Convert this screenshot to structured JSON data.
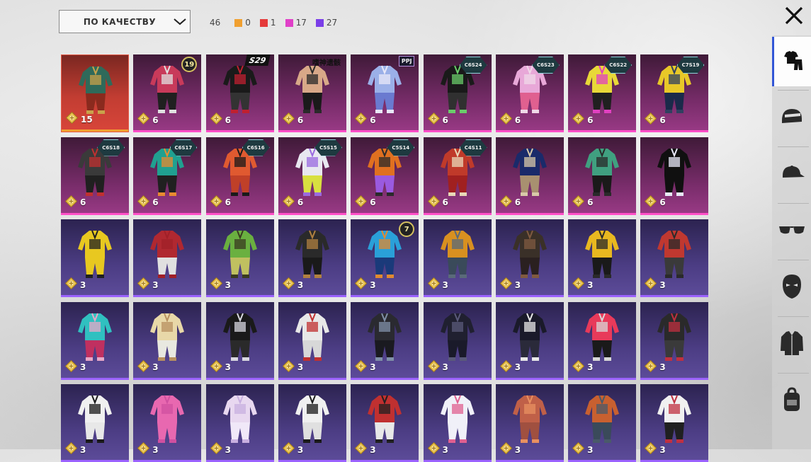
{
  "sort": {
    "label": "ПО КАЧЕСТВУ"
  },
  "counts": {
    "total": "46",
    "items": [
      {
        "value": "0",
        "color": "#f0a030"
      },
      {
        "value": "1",
        "color": "#e53a3a"
      },
      {
        "value": "17",
        "color": "#e040c8"
      },
      {
        "value": "27",
        "color": "#7a3ee8"
      }
    ]
  },
  "colors": {
    "accent": "#3256d6",
    "gold_bar": "#f0a030",
    "pink_bar": "#ff4fc8",
    "violet_bar": "#9b62ff"
  },
  "items": [
    {
      "rarity": "gold",
      "cost": "15",
      "badge": "",
      "btype": "",
      "palette": [
        "#2f6a5a",
        "#c9a24a",
        "#8a2a1e"
      ]
    },
    {
      "rarity": "pink",
      "cost": "6",
      "badge": "19",
      "btype": "circle",
      "palette": [
        "#c83a5a",
        "#e0e0e0",
        "#202020"
      ]
    },
    {
      "rarity": "pink",
      "cost": "6",
      "badge": "S29",
      "btype": "s29",
      "palette": [
        "#1a1a1a",
        "#c02030",
        "#333"
      ]
    },
    {
      "rarity": "pink",
      "cost": "6",
      "badge": "嗜神遗骸",
      "btype": "script",
      "palette": [
        "#d8a888",
        "#2a2a2a",
        "#1a1a1a"
      ]
    },
    {
      "rarity": "pink",
      "cost": "6",
      "badge": "PPJ",
      "btype": "tag",
      "palette": [
        "#9bb0e8",
        "#e8e8f8",
        "#6a7ad0"
      ]
    },
    {
      "rarity": "pink",
      "cost": "6",
      "badge": "C6S24",
      "btype": "hex",
      "palette": [
        "#1a1a1a",
        "#6acc6a",
        "#303030"
      ]
    },
    {
      "rarity": "pink",
      "cost": "6",
      "badge": "C6S23",
      "btype": "hex",
      "palette": [
        "#e8a8d8",
        "#f0d8e8",
        "#e06090"
      ]
    },
    {
      "rarity": "pink",
      "cost": "6",
      "badge": "C6S22",
      "btype": "hex",
      "palette": [
        "#e8d838",
        "#e040c0",
        "#202020"
      ]
    },
    {
      "rarity": "pink",
      "cost": "6",
      "badge": "C7S19",
      "btype": "hex",
      "palette": [
        "#e8c828",
        "#304060",
        "#1a2a4a"
      ]
    },
    {
      "rarity": "pink",
      "cost": "6",
      "badge": "C6S18",
      "btype": "hex",
      "palette": [
        "#3a3a3a",
        "#c03030",
        "#202020"
      ]
    },
    {
      "rarity": "pink",
      "cost": "6",
      "badge": "C6S17",
      "btype": "hex",
      "palette": [
        "#20a090",
        "#e88a30",
        "#202020"
      ]
    },
    {
      "rarity": "pink",
      "cost": "6",
      "badge": "C6S16",
      "btype": "hex",
      "palette": [
        "#e05a30",
        "#1a1a1a",
        "#c04028"
      ]
    },
    {
      "rarity": "pink",
      "cost": "6",
      "badge": "C5S15",
      "btype": "hex",
      "palette": [
        "#e8e8f0",
        "#9a6ae0",
        "#d8e040"
      ]
    },
    {
      "rarity": "pink",
      "cost": "6",
      "badge": "C5S14",
      "btype": "hex",
      "palette": [
        "#e07020",
        "#2a2a2a",
        "#9a5ae0"
      ]
    },
    {
      "rarity": "pink",
      "cost": "6",
      "badge": "C4S11",
      "btype": "hex",
      "palette": [
        "#c03a2a",
        "#e8d8b8",
        "#a02020"
      ]
    },
    {
      "rarity": "pink",
      "cost": "6",
      "badge": "",
      "btype": "",
      "palette": [
        "#1a2a6a",
        "#d8c8a8",
        "#a89070"
      ]
    },
    {
      "rarity": "pink",
      "cost": "6",
      "badge": "",
      "btype": "",
      "palette": [
        "#40a080",
        "#2a2a2a",
        "#1a1a1a"
      ]
    },
    {
      "rarity": "pink",
      "cost": "6",
      "badge": "",
      "btype": "",
      "palette": [
        "#101010",
        "#e8e8f8",
        "#101010"
      ]
    },
    {
      "rarity": "violet",
      "cost": "3",
      "badge": "",
      "btype": "",
      "palette": [
        "#e8c820",
        "#202020",
        "#e8c820"
      ]
    },
    {
      "rarity": "violet",
      "cost": "3",
      "badge": "",
      "btype": "",
      "palette": [
        "#b02830",
        "#a02028",
        "#e0e0e0"
      ]
    },
    {
      "rarity": "violet",
      "cost": "3",
      "badge": "",
      "btype": "",
      "palette": [
        "#6ab040",
        "#3a3a20",
        "#c0c060"
      ]
    },
    {
      "rarity": "violet",
      "cost": "3",
      "badge": "",
      "btype": "",
      "palette": [
        "#2a2a2a",
        "#b08040",
        "#1a1a1a"
      ]
    },
    {
      "rarity": "violet",
      "cost": "3",
      "badge": "7",
      "btype": "circle",
      "palette": [
        "#2aa0d8",
        "#e08a30",
        "#1a3a7a"
      ]
    },
    {
      "rarity": "violet",
      "cost": "3",
      "badge": "",
      "btype": "",
      "palette": [
        "#d89020",
        "#5a6a7a",
        "#3a4a5a"
      ]
    },
    {
      "rarity": "violet",
      "cost": "3",
      "badge": "",
      "btype": "",
      "palette": [
        "#3a3028",
        "#805a40",
        "#2a2020"
      ]
    },
    {
      "rarity": "violet",
      "cost": "3",
      "badge": "",
      "btype": "",
      "palette": [
        "#e8b820",
        "#2a2a2a",
        "#1a1a1a"
      ]
    },
    {
      "rarity": "violet",
      "cost": "3",
      "badge": "",
      "btype": "",
      "palette": [
        "#c03830",
        "#2a2a2a",
        "#3a3a3a"
      ]
    },
    {
      "rarity": "violet",
      "cost": "3",
      "badge": "",
      "btype": "",
      "palette": [
        "#30c0c0",
        "#e8a8c8",
        "#c03060"
      ]
    },
    {
      "rarity": "violet",
      "cost": "3",
      "badge": "",
      "btype": "",
      "palette": [
        "#e8d8a8",
        "#b89060",
        "#e8e8e0"
      ]
    },
    {
      "rarity": "violet",
      "cost": "3",
      "badge": "",
      "btype": "",
      "palette": [
        "#1a1a1a",
        "#d8d8e0",
        "#2a2a2a"
      ]
    },
    {
      "rarity": "violet",
      "cost": "3",
      "badge": "",
      "btype": "",
      "palette": [
        "#e8e8e8",
        "#c03030",
        "#d8d8d8"
      ]
    },
    {
      "rarity": "violet",
      "cost": "3",
      "badge": "",
      "btype": "",
      "palette": [
        "#2a2a30",
        "#8090a8",
        "#1a1a20"
      ]
    },
    {
      "rarity": "violet",
      "cost": "3",
      "badge": "",
      "btype": "",
      "palette": [
        "#202030",
        "#5a5a7a",
        "#1a1a2a"
      ]
    },
    {
      "rarity": "violet",
      "cost": "3",
      "badge": "",
      "btype": "",
      "palette": [
        "#1a1a2a",
        "#e8e8e8",
        "#2a2a3a"
      ]
    },
    {
      "rarity": "violet",
      "cost": "3",
      "badge": "",
      "btype": "",
      "palette": [
        "#e83a5a",
        "#d8d8d8",
        "#1a1a1a"
      ]
    },
    {
      "rarity": "violet",
      "cost": "3",
      "badge": "",
      "btype": "",
      "palette": [
        "#2a2a2a",
        "#c03040",
        "#3a3a3a"
      ]
    },
    {
      "rarity": "violet",
      "cost": "3",
      "badge": "",
      "btype": "",
      "palette": [
        "#f0f0f0",
        "#1a1a1a",
        "#e8e8e8"
      ]
    },
    {
      "rarity": "violet",
      "cost": "3",
      "badge": "",
      "btype": "",
      "palette": [
        "#e868b0",
        "#d050a0",
        "#e868b0"
      ]
    },
    {
      "rarity": "violet",
      "cost": "3",
      "badge": "",
      "btype": "",
      "palette": [
        "#e8d8f0",
        "#c8b0e0",
        "#f0e8f8"
      ]
    },
    {
      "rarity": "violet",
      "cost": "3",
      "badge": "",
      "btype": "",
      "palette": [
        "#f0f0f0",
        "#1a1a1a",
        "#e0e0e0"
      ]
    },
    {
      "rarity": "violet",
      "cost": "3",
      "badge": "",
      "btype": "",
      "palette": [
        "#c03030",
        "#202020",
        "#e8e8e8"
      ]
    },
    {
      "rarity": "violet",
      "cost": "3",
      "badge": "",
      "btype": "",
      "palette": [
        "#f0f0f8",
        "#e06090",
        "#f0f0f8"
      ]
    },
    {
      "rarity": "violet",
      "cost": "3",
      "badge": "",
      "btype": "",
      "palette": [
        "#c06048",
        "#e89060",
        "#a05040"
      ]
    },
    {
      "rarity": "violet",
      "cost": "3",
      "badge": "",
      "btype": "",
      "palette": [
        "#c86030",
        "#4a5a6a",
        "#3a4a5a"
      ]
    },
    {
      "rarity": "violet",
      "cost": "3",
      "badge": "",
      "btype": "",
      "palette": [
        "#f0f0f0",
        "#c03040",
        "#202020"
      ]
    }
  ],
  "sidebar": {
    "active": 0,
    "tabs": [
      {
        "icon": "outfit-icon"
      },
      {
        "icon": "helmet-icon"
      },
      {
        "icon": "cap-icon"
      },
      {
        "icon": "glasses-icon"
      },
      {
        "icon": "mask-icon"
      },
      {
        "icon": "jacket-icon"
      },
      {
        "icon": "backpack-icon"
      }
    ]
  }
}
